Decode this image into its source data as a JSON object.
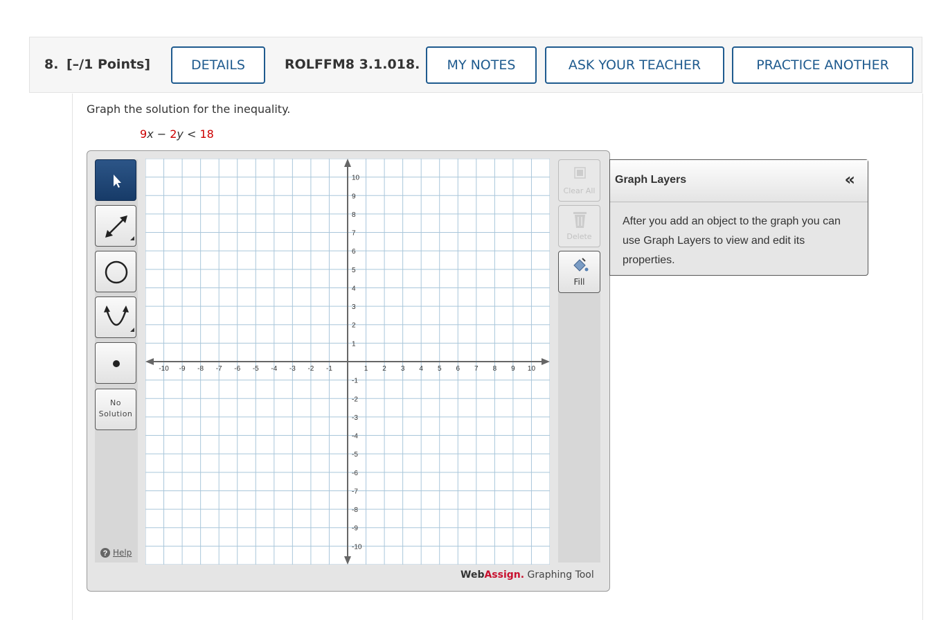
{
  "question": {
    "number": "8.",
    "points": "[–/1 Points]",
    "details_label": "DETAILS",
    "reference": "ROLFFM8 3.1.018.",
    "my_notes_label": "MY NOTES",
    "ask_teacher_label": "ASK YOUR TEACHER",
    "practice_label": "PRACTICE ANOTHER",
    "prompt": "Graph the solution for the inequality.",
    "inequality": {
      "c1": "9",
      "v1": "x",
      "op1": " − ",
      "c2": "2",
      "v2": "y",
      "op2": " < ",
      "c3": "18"
    }
  },
  "tool": {
    "left_tools": [
      {
        "name": "select-tool",
        "icon": "arrow-pointer-icon",
        "selected": true
      },
      {
        "name": "line-tool",
        "icon": "double-arrow-line-icon"
      },
      {
        "name": "circle-tool",
        "icon": "circle-icon"
      },
      {
        "name": "parabola-tool",
        "icon": "parabola-icon"
      },
      {
        "name": "point-tool",
        "icon": "dot-icon"
      }
    ],
    "no_solution_line1": "No",
    "no_solution_line2": "Solution",
    "help_label": "Help",
    "clear_all_label": "Clear All",
    "delete_label": "Delete",
    "fill_label": "Fill",
    "brand_web": "Web",
    "brand_assign": "Assign.",
    "brand_suffix": " Graphing Tool",
    "accent_color": "#1e5a8e",
    "brand_red": "#c8102e"
  },
  "layers": {
    "title": "Graph Layers",
    "collapse_glyph": "«",
    "message": "After you add an object to the graph you can use Graph Layers to view and edit its properties."
  },
  "chart_data": {
    "type": "scatter",
    "xlim": [
      -11,
      11
    ],
    "ylim": [
      -11,
      11
    ],
    "x_ticks": [
      -10,
      -9,
      -8,
      -7,
      -6,
      -5,
      -4,
      -3,
      -2,
      -1,
      1,
      2,
      3,
      4,
      5,
      6,
      7,
      8,
      9,
      10
    ],
    "y_ticks": [
      -10,
      -9,
      -8,
      -7,
      -6,
      -5,
      -4,
      -3,
      -2,
      -1,
      1,
      2,
      3,
      4,
      5,
      6,
      7,
      8,
      9,
      10
    ],
    "grid": true,
    "series": []
  }
}
